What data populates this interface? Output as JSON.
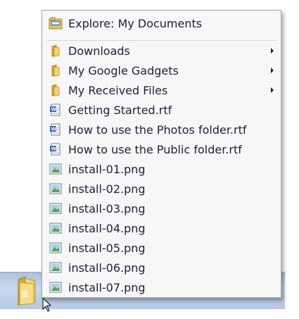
{
  "menu": {
    "header": {
      "label": "Explore: My Documents",
      "icon": "explore-folder-icon"
    },
    "items": [
      {
        "label": "Downloads",
        "icon": "folder-icon",
        "submenu": true
      },
      {
        "label": "My Google Gadgets",
        "icon": "folder-icon",
        "submenu": true
      },
      {
        "label": "My Received Files",
        "icon": "folder-icon",
        "submenu": true
      },
      {
        "label": "Getting Started.rtf",
        "icon": "rtf-document-icon",
        "submenu": false
      },
      {
        "label": "How to use the Photos folder.rtf",
        "icon": "rtf-document-icon",
        "submenu": false
      },
      {
        "label": "How to use the Public folder.rtf",
        "icon": "rtf-document-icon",
        "submenu": false
      },
      {
        "label": "install-01.png",
        "icon": "image-file-icon",
        "submenu": false
      },
      {
        "label": "install-02.png",
        "icon": "image-file-icon",
        "submenu": false
      },
      {
        "label": "install-03.png",
        "icon": "image-file-icon",
        "submenu": false
      },
      {
        "label": "install-04.png",
        "icon": "image-file-icon",
        "submenu": false
      },
      {
        "label": "install-05.png",
        "icon": "image-file-icon",
        "submenu": false
      },
      {
        "label": "install-06.png",
        "icon": "image-file-icon",
        "submenu": false
      },
      {
        "label": "install-07.png",
        "icon": "image-file-icon",
        "submenu": false
      }
    ]
  },
  "taskbar": {
    "button_icon": "folder-icon"
  }
}
